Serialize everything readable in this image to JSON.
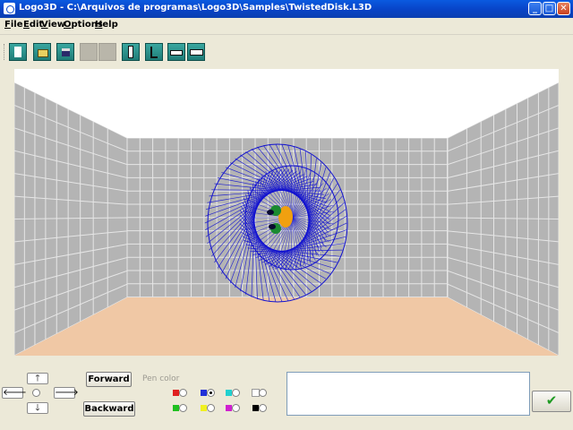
{
  "window": {
    "title": "Logo3D - C:\\Arquivos de programas\\Logo3D\\Samples\\TwistedDisk.L3D",
    "minimize_glyph": "_",
    "maximize_glyph": "□",
    "close_glyph": "✕"
  },
  "menu": {
    "items": [
      {
        "label": "File",
        "underline": "F",
        "rest": "ile"
      },
      {
        "label": "Edit",
        "underline": "E",
        "rest": "dit"
      },
      {
        "label": "View",
        "underline": "V",
        "rest": "iew"
      },
      {
        "label": "Options",
        "underline": "O",
        "rest": "ptions"
      },
      {
        "label": "Help",
        "underline": "H",
        "rest": "elp"
      }
    ]
  },
  "toolbar": {
    "buttons": [
      {
        "name": "new-file-icon",
        "enabled": true
      },
      {
        "name": "open-file-icon",
        "enabled": true
      },
      {
        "name": "save-file-icon",
        "enabled": true
      },
      {
        "name": "cut-icon",
        "enabled": false
      },
      {
        "name": "copy-icon",
        "enabled": false
      },
      {
        "name": "view-front-icon",
        "enabled": true
      },
      {
        "name": "view-side-icon",
        "enabled": true
      },
      {
        "name": "camera-icon",
        "enabled": true
      },
      {
        "name": "run-icon",
        "enabled": true
      }
    ]
  },
  "controls": {
    "up_glyph": "🡑",
    "down_glyph": "🡓",
    "left_glyph": "🡐",
    "right_glyph": "🡒",
    "forward_label": "Forward",
    "backward_label": "Backward",
    "pen_color_label": "Pen color",
    "pen_colors": [
      {
        "color": "#e02020",
        "selected": false
      },
      {
        "color": "#2030d8",
        "selected": true
      },
      {
        "color": "#20d0d0",
        "selected": false
      },
      {
        "color": "#ffffff",
        "selected": false
      },
      {
        "color": "#20c020",
        "selected": false
      },
      {
        "color": "#f0f020",
        "selected": false
      },
      {
        "color": "#d020d0",
        "selected": false
      },
      {
        "color": "#000000",
        "selected": false
      }
    ],
    "command_text": "",
    "ok_glyph": "✔"
  },
  "scene": {
    "wall_color": "#b4b4b4",
    "grid_color": "#e6e6e6",
    "floor_color": "#f0c8a5",
    "ceiling_color": "#ffffff",
    "line_color": "#1010d0",
    "turtle_colors": [
      "#f0a010",
      "#1a8a30",
      "#0a0a30"
    ]
  }
}
